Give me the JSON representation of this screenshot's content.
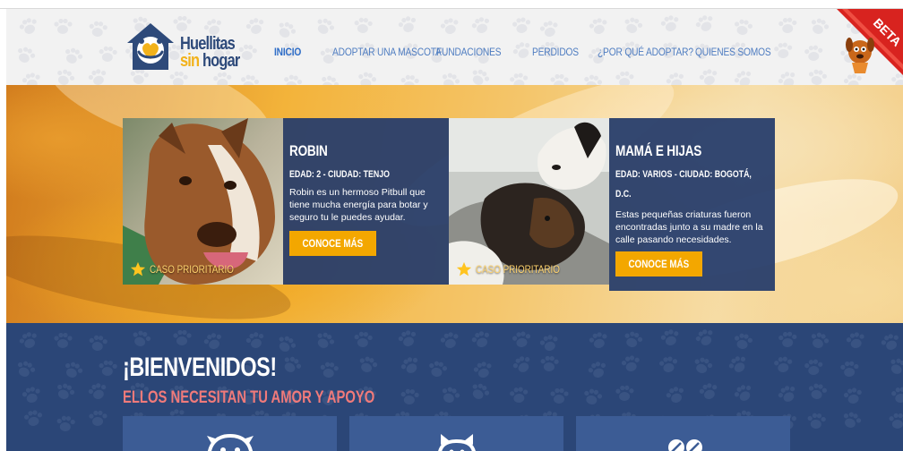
{
  "brand": {
    "line1": "Huellitas",
    "line2_a": "sin",
    "line2_b": "hogar"
  },
  "nav": {
    "items": [
      {
        "label": "INICIO",
        "active": true
      },
      {
        "label": "ADOPTAR UNA MASCOTA",
        "active": false
      },
      {
        "label": "FUNDACIONES",
        "active": false
      },
      {
        "label": "PERDIDOS",
        "active": false
      },
      {
        "label": "¿POR QUÉ ADOPTAR?",
        "active": false
      },
      {
        "label": "QUIENES SOMOS",
        "active": false
      }
    ]
  },
  "beta_badge": "BETA",
  "cards": [
    {
      "name": "ROBIN",
      "meta": "EDAD: 2 - CIUDAD: TENJO",
      "description": "Robin es un hermoso Pitbull que tiene mucha energía para botar y seguro tu le puedes ayudar.",
      "button": "CONOCE MÁS",
      "priority_label": "CASO PRIORITARIO"
    },
    {
      "name": "MAMÁ E HIJAS",
      "meta": "EDAD: VARIOS - CIUDAD: BOGOTÁ, D.C.",
      "description": "Estas pequeñas criaturas fueron encontradas junto a su madre en la calle pasando necesidades.",
      "button": "CONOCE MÁS",
      "priority_label": "CASO PRIORITARIO"
    }
  ],
  "welcome": {
    "title": "¡BIENVENIDOS!",
    "subtitle": "ELLOS NECESITAN TU AMOR Y APOYO"
  },
  "colors": {
    "header_bg": "#f2f2f2",
    "nav_link": "#4f7dc1",
    "brand_blue": "#2e4a7a",
    "brand_yellow": "#f2b21b",
    "panel_blue": "#263d6b",
    "button_orange": "#f3a700",
    "section_blue": "#2b4677",
    "subtitle_pink": "#f07a7a",
    "beta_red": "#d8231f"
  },
  "icons": [
    "paw-pattern-icon",
    "house-heart-logo-icon",
    "star-icon",
    "dog-face-icon",
    "cat-face-icon",
    "paw-prints-icon"
  ]
}
